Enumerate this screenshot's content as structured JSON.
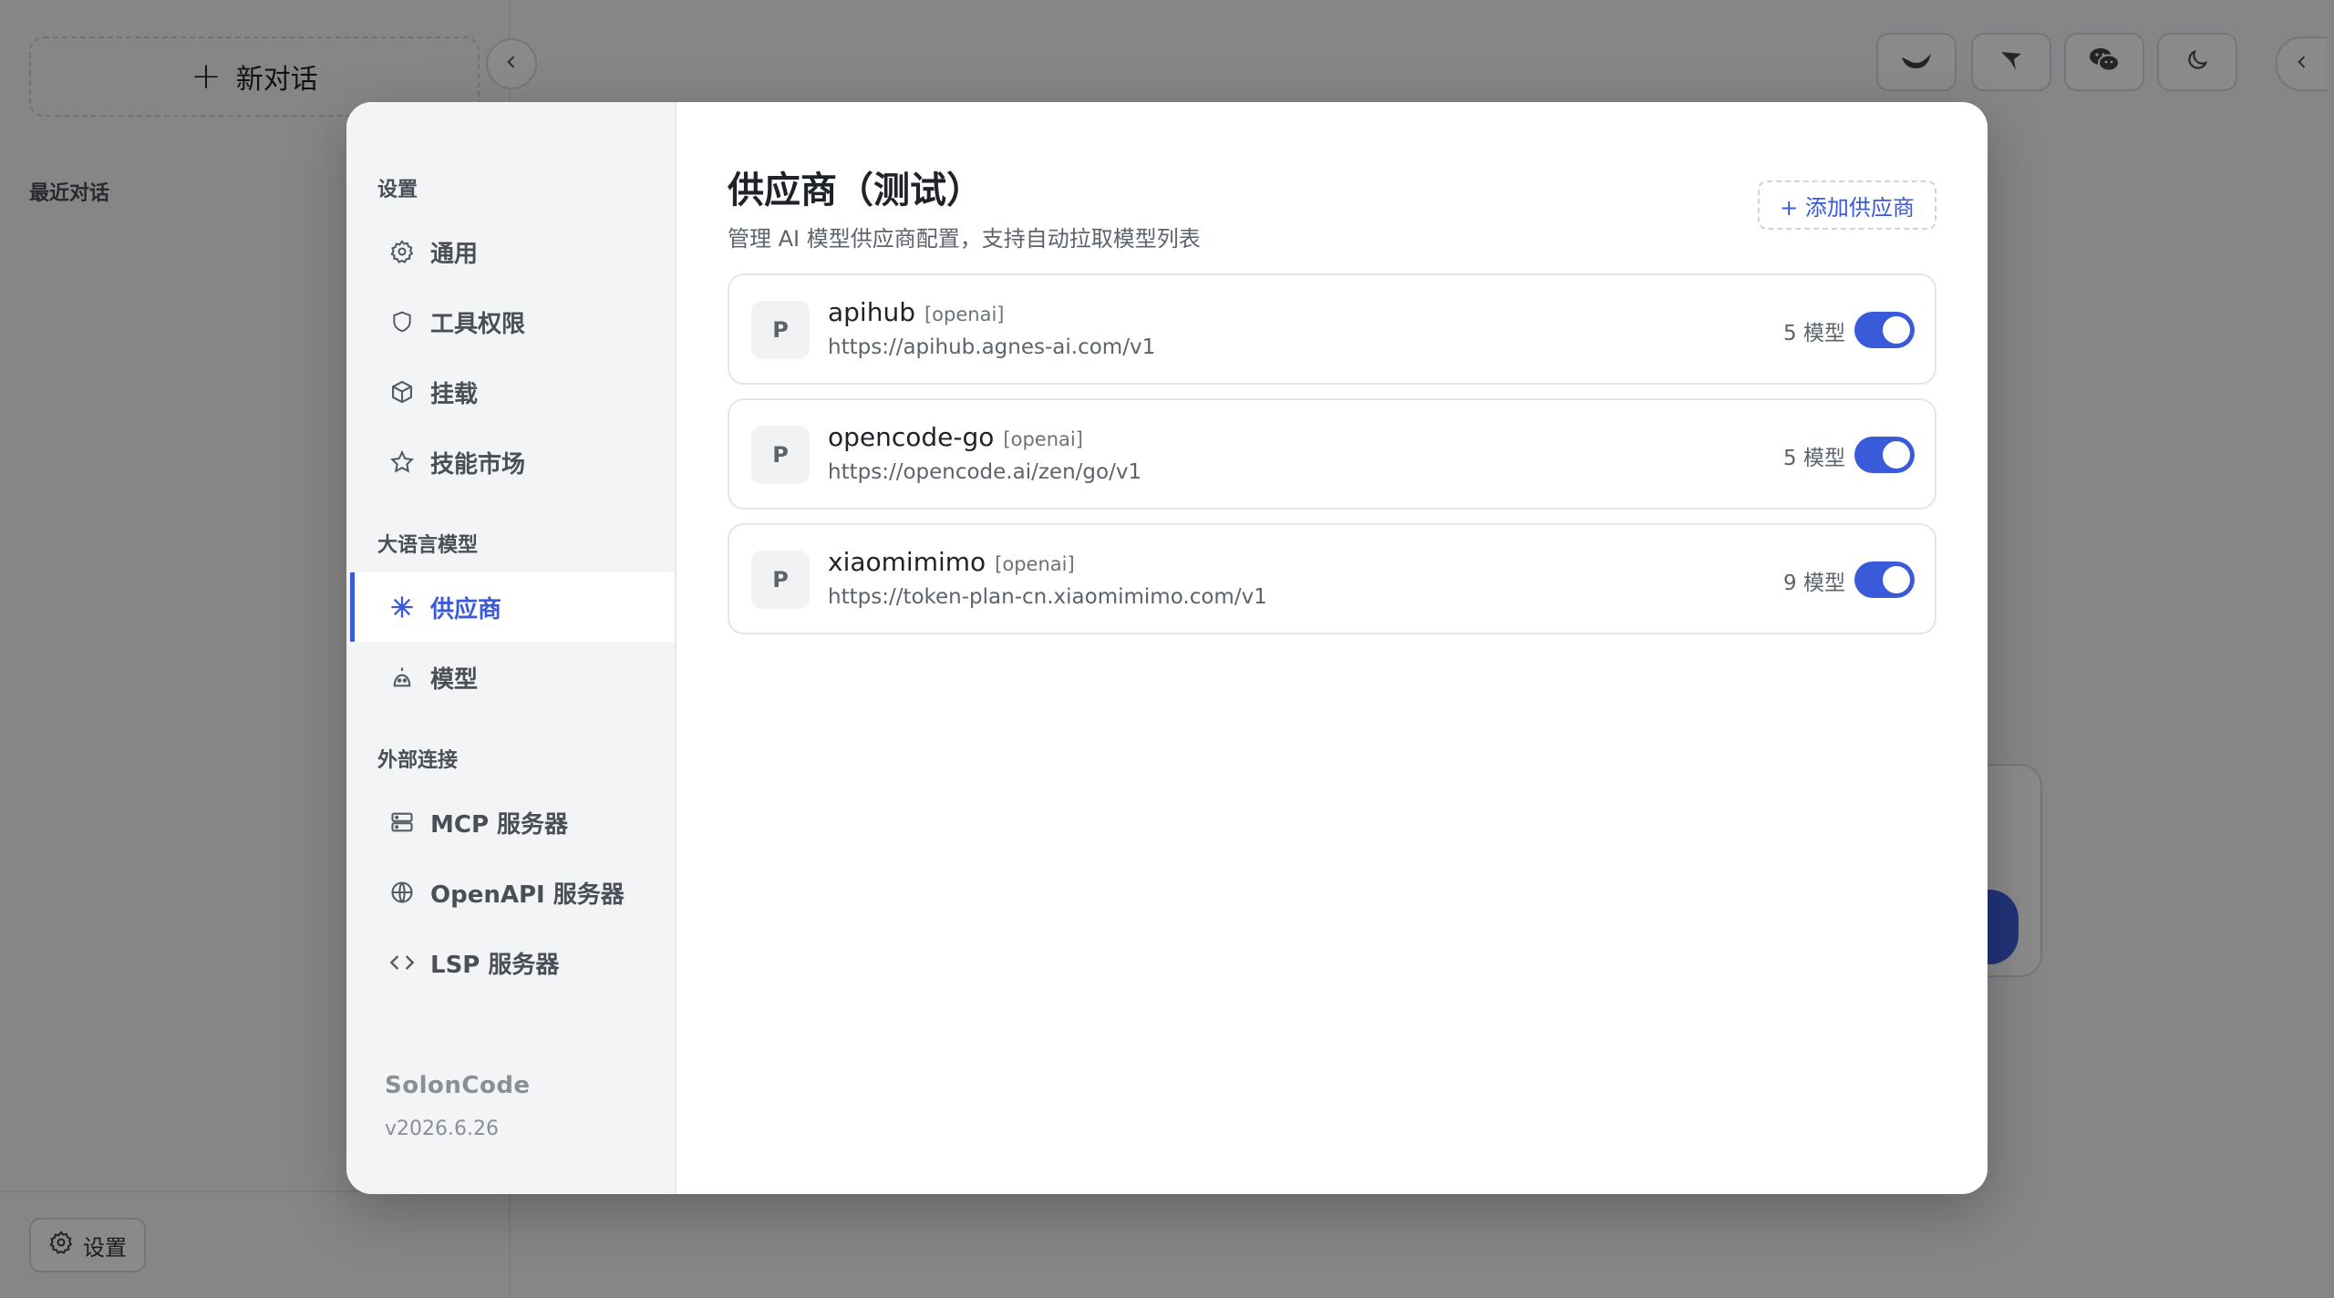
{
  "background": {
    "new_chat_label": "新对话",
    "recent_label": "最近对话",
    "settings_label": "设置"
  },
  "modal": {
    "sidebar": {
      "groups": [
        {
          "label": "设置",
          "items": [
            {
              "label": "通用",
              "icon": "gear-icon"
            },
            {
              "label": "工具权限",
              "icon": "shield-icon"
            },
            {
              "label": "挂载",
              "icon": "cube-icon"
            },
            {
              "label": "技能市场",
              "icon": "star-icon"
            }
          ]
        },
        {
          "label": "大语言模型",
          "items": [
            {
              "label": "供应商",
              "icon": "asterisk-icon",
              "active": true
            },
            {
              "label": "模型",
              "icon": "model-icon"
            }
          ]
        },
        {
          "label": "外部连接",
          "items": [
            {
              "label": "MCP 服务器",
              "icon": "server-icon"
            },
            {
              "label": "OpenAPI 服务器",
              "icon": "globe-icon"
            },
            {
              "label": "LSP 服务器",
              "icon": "code-icon"
            }
          ]
        }
      ],
      "app_name": "SolonCode",
      "version": "v2026.6.26"
    },
    "main": {
      "title": "供应商（测试）",
      "subtitle": "管理 AI 模型供应商配置，支持自动拉取模型列表",
      "add_button": "+ 添加供应商",
      "providers": [
        {
          "avatar": "P",
          "name": "apihub",
          "type": "[openai]",
          "url": "https://apihub.agnes-ai.com/v1",
          "models": "5 模型",
          "enabled": true
        },
        {
          "avatar": "P",
          "name": "opencode-go",
          "type": "[openai]",
          "url": "https://opencode.ai/zen/go/v1",
          "models": "5 模型",
          "enabled": true
        },
        {
          "avatar": "P",
          "name": "xiaomimimo",
          "type": "[openai]",
          "url": "https://token-plan-cn.xiaomimimo.com/v1",
          "models": "9 模型",
          "enabled": true
        }
      ]
    }
  },
  "colors": {
    "accent": "#3a5bd9",
    "overlay": "rgba(0,0,0,0.46)"
  }
}
